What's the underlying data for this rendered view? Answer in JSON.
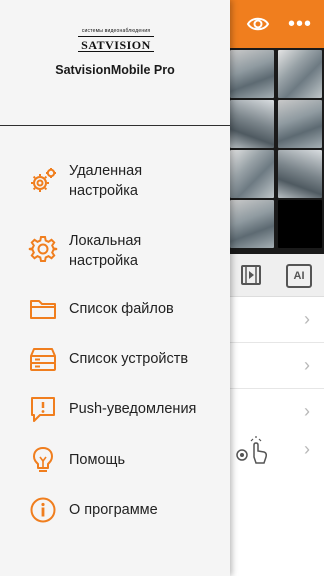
{
  "app": {
    "name": "SatvisionMobile Pro",
    "logo_tagline": "системы видеонаблюдения",
    "logo_brand": "SATVISION"
  },
  "menu": [
    {
      "label_line1": "Удаленная",
      "label_line2": "настройка",
      "icon": "gear-remote-icon"
    },
    {
      "label_line1": "Локальная",
      "label_line2": "настройка",
      "icon": "gear-icon"
    },
    {
      "label": "Список файлов",
      "icon": "folder-icon"
    },
    {
      "label": "Список устройств",
      "icon": "device-list-icon"
    },
    {
      "label": "Push-уведомления",
      "icon": "notification-icon"
    },
    {
      "label": "Помощь",
      "icon": "lightbulb-icon"
    },
    {
      "label": "О программе",
      "icon": "info-icon"
    }
  ],
  "background": {
    "toolbar_ai_label": "AI",
    "more_label": "•••"
  },
  "colors": {
    "accent": "#f07e1e",
    "drawer_bg": "#f5f5f5",
    "text": "#222222"
  }
}
